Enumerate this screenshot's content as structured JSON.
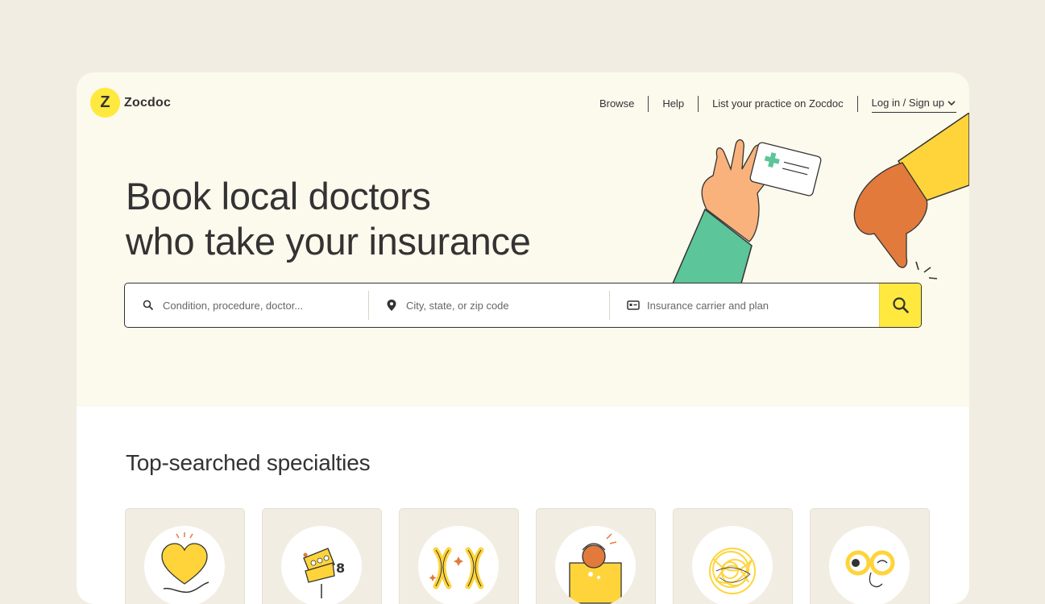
{
  "brand": {
    "logo_mark": "Z",
    "name": "Zocdoc",
    "accent": "#ffe93f"
  },
  "nav": {
    "items": [
      "Browse",
      "Help",
      "List your practice on Zocdoc"
    ],
    "login_label": "Log in / Sign up"
  },
  "hero": {
    "headline_line1": "Book local doctors",
    "headline_line2": "who take your insurance"
  },
  "search": {
    "condition_placeholder": "Condition, procedure, doctor...",
    "location_placeholder": "City, state, or zip code",
    "insurance_placeholder": "Insurance carrier and plan",
    "icons": [
      "search-icon",
      "location-pin-icon",
      "insurance-card-icon",
      "search-icon"
    ]
  },
  "specialties": {
    "title": "Top-searched specialties",
    "cards": [
      {
        "icon": "heart-hand-icon"
      },
      {
        "icon": "teeth-icon"
      },
      {
        "icon": "chromosome-icon"
      },
      {
        "icon": "eye-icon"
      },
      {
        "icon": "scribble-icon"
      },
      {
        "icon": "glasses-icon"
      }
    ]
  },
  "colors": {
    "background": "#f2ede2",
    "hero": "#fcf9ed",
    "card": "#f2ede2",
    "green": "#5cc59a",
    "orange": "#e27a3c"
  }
}
